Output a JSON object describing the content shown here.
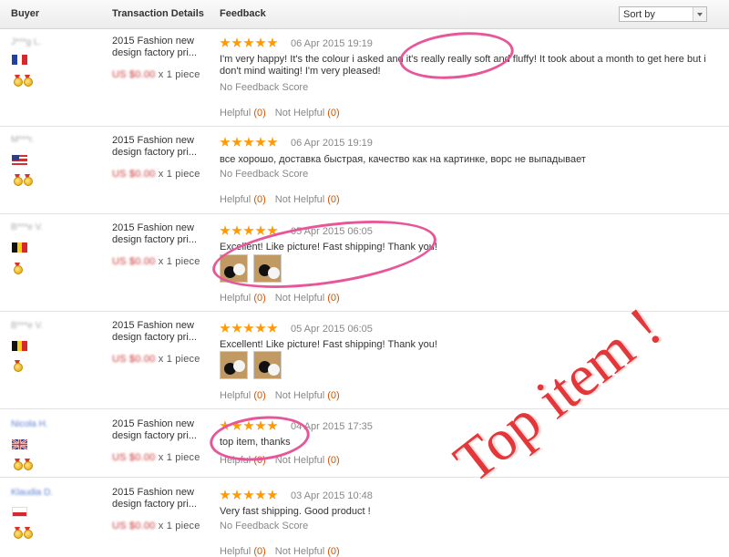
{
  "header": {
    "buyer": "Buyer",
    "transaction_details": "Transaction Details",
    "feedback": "Feedback",
    "sort_by": "Sort by"
  },
  "rows": [
    {
      "buyer": "J***g L.",
      "flag": "FR",
      "medals": 2,
      "product": "2015 Fashion new design factory pri...",
      "price": "US $0.00",
      "qty": "x 1 piece",
      "stars": 5,
      "date": "06 Apr 2015 19:19",
      "text": "I'm very happy! It's the colour i asked and it's really really soft and fluffy! It took about a month to get here but i don't mind waiting! I'm very pleased!",
      "no_score": "No Feedback Score",
      "helpful": "Helpful",
      "helpful_count": "(0)",
      "not_helpful": "Not Helpful",
      "not_helpful_count": "(0)"
    },
    {
      "buyer": "M***r.",
      "flag": "US",
      "medals": 2,
      "product": "2015 Fashion new design factory pri...",
      "price": "US $0.00",
      "qty": "x 1 piece",
      "stars": 5,
      "date": "06 Apr 2015 19:19",
      "text": "все хорошо, доставка быстрая, качество как на картинке, ворс не выпадывает",
      "no_score": "No Feedback Score",
      "helpful": "Helpful",
      "helpful_count": "(0)",
      "not_helpful": "Not Helpful",
      "not_helpful_count": "(0)"
    },
    {
      "buyer": "B***e V.",
      "flag": "BE",
      "medals": 1,
      "product": "2015 Fashion new design factory pri...",
      "price": "US $0.00",
      "qty": "x 1 piece",
      "stars": 5,
      "date": "05 Apr 2015 06:05",
      "text": "Excellent! Like picture! Fast shipping! Thank you!",
      "helpful": "Helpful",
      "helpful_count": "(0)",
      "not_helpful": "Not Helpful",
      "not_helpful_count": "(0)"
    },
    {
      "buyer": "B***e V.",
      "flag": "BE",
      "medals": 1,
      "product": "2015 Fashion new design factory pri...",
      "price": "US $0.00",
      "qty": "x 1 piece",
      "stars": 5,
      "date": "05 Apr 2015 06:05",
      "text": "Excellent! Like picture! Fast shipping! Thank you!",
      "helpful": "Helpful",
      "helpful_count": "(0)",
      "not_helpful": "Not Helpful",
      "not_helpful_count": "(0)"
    },
    {
      "buyer": "Nicola H.",
      "flag": "GB",
      "medals": 2,
      "product": "2015 Fashion new design factory pri...",
      "price": "US $0.00",
      "qty": "x 1 piece",
      "stars": 5,
      "date": "04 Apr 2015 17:35",
      "text": "top item, thanks",
      "helpful": "Helpful",
      "helpful_count": "(0)",
      "not_helpful": "Not Helpful",
      "not_helpful_count": "(0)"
    },
    {
      "buyer": "Klaudia D.",
      "flag": "PL",
      "medals": 2,
      "product": "2015 Fashion new design factory pri...",
      "price": "US $0.00",
      "qty": "x 1 piece",
      "stars": 5,
      "date": "03 Apr 2015 10:48",
      "text": "Very fast shipping. Good product !",
      "no_score": "No Feedback Score",
      "helpful": "Helpful",
      "helpful_count": "(0)",
      "not_helpful": "Not Helpful",
      "not_helpful_count": "(0)"
    }
  ],
  "overlay_text": "Top item !",
  "colors": {
    "star": "#ff9a00",
    "highlight": "#e8569a",
    "overlay": "#e3373a",
    "count": "#d35400"
  }
}
